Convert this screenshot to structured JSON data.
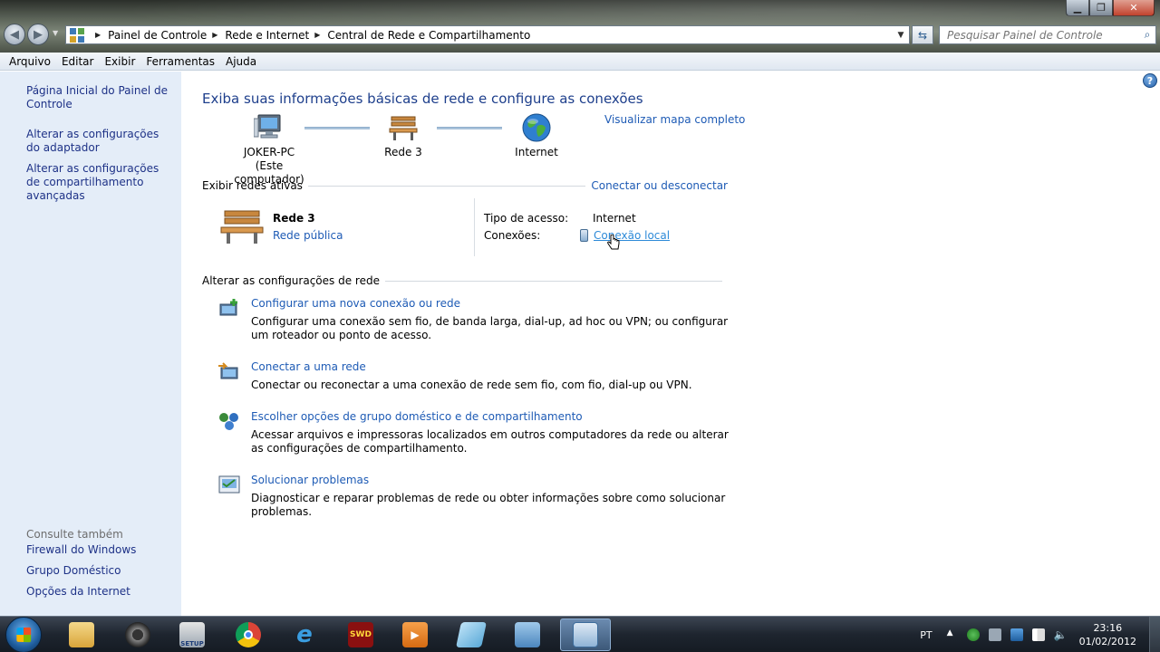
{
  "window": {
    "minimize": "▁",
    "maximize": "❐",
    "close": "✕"
  },
  "breadcrumbs": [
    "Painel de Controle",
    "Rede e Internet",
    "Central de Rede e Compartilhamento"
  ],
  "search": {
    "placeholder": "Pesquisar Painel de Controle"
  },
  "menu": [
    "Arquivo",
    "Editar",
    "Exibir",
    "Ferramentas",
    "Ajuda"
  ],
  "sidebar": {
    "links": [
      "Página Inicial do Painel de Controle",
      "Alterar as configurações do adaptador",
      "Alterar as configurações de compartilhamento avançadas"
    ],
    "see_also_label": "Consulte também",
    "see_also": [
      "Firewall do Windows",
      "Grupo Doméstico",
      "Opções da Internet"
    ]
  },
  "main": {
    "title": "Exiba suas informações básicas de rede e configure as conexões",
    "view_full_map": "Visualizar mapa completo",
    "map": {
      "computer_name": "JOKER-PC",
      "computer_sub": "(Este computador)",
      "network": "Rede  3",
      "internet": "Internet"
    },
    "active_networks": {
      "header": "Exibir redes ativas",
      "connect_link": "Conectar ou desconectar",
      "network_name": "Rede  3",
      "network_type": "Rede pública",
      "access_type_label": "Tipo de acesso:",
      "access_type_value": "Internet",
      "connections_label": "Conexões:",
      "connections_value": "Conexão local"
    },
    "change_settings": {
      "header": "Alterar as configurações de rede",
      "tasks": [
        {
          "title": "Configurar uma nova conexão ou rede",
          "desc": "Configurar uma conexão sem fio, de banda larga, dial-up, ad hoc ou VPN; ou configurar um roteador ou ponto de acesso."
        },
        {
          "title": "Conectar a uma rede",
          "desc": "Conectar ou reconectar a uma conexão de rede sem fio, com fio, dial-up ou VPN."
        },
        {
          "title": "Escolher opções de grupo doméstico e de compartilhamento",
          "desc": "Acessar arquivos e impressoras localizados em outros computadores da rede ou alterar as configurações de compartilhamento."
        },
        {
          "title": "Solucionar problemas",
          "desc": "Diagnosticar e reparar problemas de rede ou obter informações sobre como solucionar problemas."
        }
      ]
    }
  },
  "taskbar": {
    "apps": [
      {
        "icon": "explorer-icon",
        "label": ""
      },
      {
        "icon": "media-icon",
        "label": ""
      },
      {
        "icon": "setup-icon",
        "label": "SETUP"
      },
      {
        "icon": "chrome-icon",
        "label": ""
      },
      {
        "icon": "ie-icon",
        "label": ""
      },
      {
        "icon": "swd-icon",
        "label": "SWD"
      },
      {
        "icon": "player-icon",
        "label": ""
      },
      {
        "icon": "notepad-icon",
        "label": ""
      },
      {
        "icon": "network-users-icon",
        "label": ""
      },
      {
        "icon": "control-panel-icon",
        "label": ""
      }
    ],
    "language": "PT",
    "time": "23:16",
    "date": "01/02/2012"
  }
}
